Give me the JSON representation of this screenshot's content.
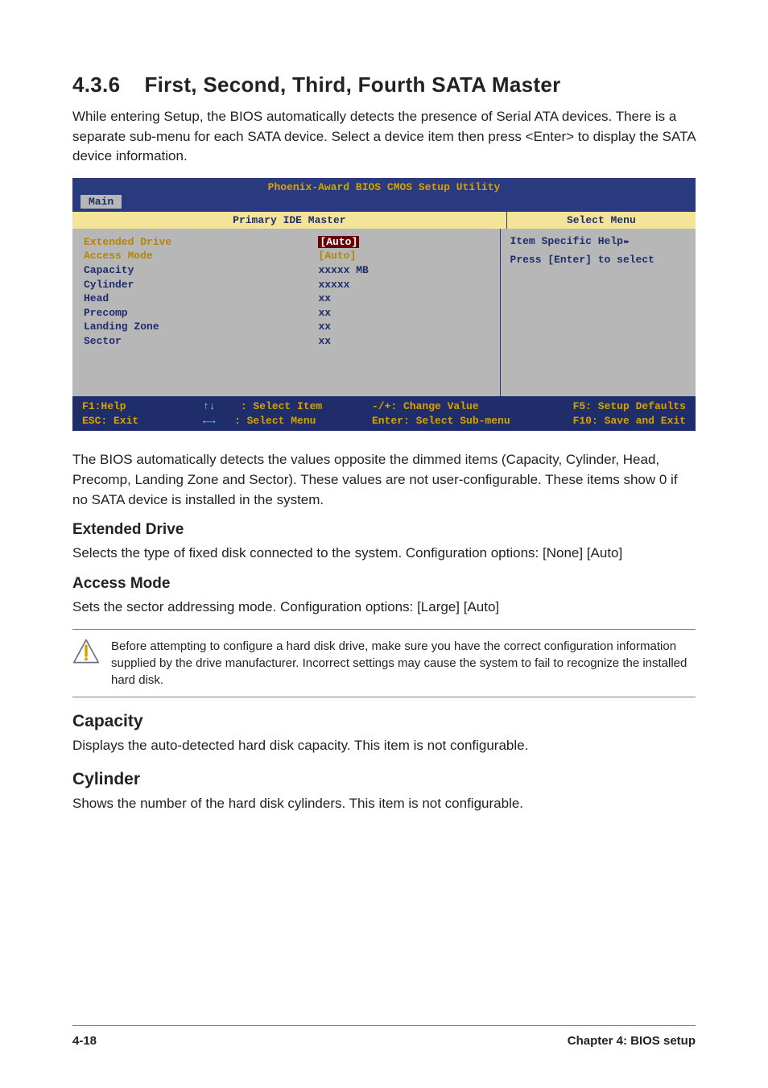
{
  "section": {
    "number": "4.3.6",
    "title": "First, Second, Third, Fourth SATA Master",
    "intro": "While entering Setup, the BIOS automatically detects the presence of Serial ATA devices. There is a separate sub-menu for each SATA device. Select a device item then press <Enter> to display the SATA device information."
  },
  "bios": {
    "title": "Phoenix-Award BIOS CMOS Setup Utility",
    "tab": "Main",
    "panel_left_header": "Primary IDE Master",
    "panel_right_header": "Select Menu",
    "help_heading": "Item Specific Help",
    "help_arrows": "▸▸",
    "help_body": "Press [Enter] to select",
    "rows": [
      {
        "label": "Extended Drive",
        "value": "[Auto]",
        "selected": true,
        "yellow": true
      },
      {
        "label": "Access Mode",
        "value": "[Auto]",
        "yellow": true
      },
      {
        "label": "",
        "value": ""
      },
      {
        "label": "Capacity",
        "value": "xxxxx MB"
      },
      {
        "label": "",
        "value": ""
      },
      {
        "label": "Cylinder",
        "value": "xxxxx"
      },
      {
        "label": "Head",
        "value": "   xx"
      },
      {
        "label": "Precomp",
        "value": "   xx"
      },
      {
        "label": "Landing Zone",
        "value": "   xx"
      },
      {
        "label": "Sector",
        "value": "   xx"
      }
    ],
    "footer": {
      "r1a": "F1:Help",
      "r1b": ": Select Item",
      "r1c": "-/+:  Change Value",
      "r1d": "F5: Setup Defaults",
      "r2a": "ESC: Exit",
      "r2b": ": Select Menu",
      "r2c": "Enter: Select Sub-menu",
      "r2d": "F10: Save and Exit"
    }
  },
  "after_bios": "The BIOS automatically detects the values opposite the dimmed items (Capacity, Cylinder,  Head, Precomp, Landing Zone and Sector). These values are not user-configurable. These items show 0 if no SATA device is installed in the system.",
  "ext_drive": {
    "heading": "Extended Drive",
    "body": "Selects the type of fixed disk connected to the system. Configuration options: [None] [Auto]"
  },
  "access_mode": {
    "heading": "Access Mode",
    "body": "Sets the sector addressing mode. Configuration options: [Large] [Auto]"
  },
  "note": "Before attempting to configure a hard disk drive, make sure you have the correct configuration information supplied by the drive manufacturer. Incorrect settings may cause the system to fail to recognize the installed hard disk.",
  "capacity": {
    "heading": "Capacity",
    "body": "Displays the auto-detected hard disk capacity. This item is not configurable."
  },
  "cylinder": {
    "heading": "Cylinder",
    "body": "Shows the number of the hard disk cylinders. This item is not configurable."
  },
  "footer": {
    "left": "4-18",
    "right": "Chapter 4: BIOS setup"
  }
}
